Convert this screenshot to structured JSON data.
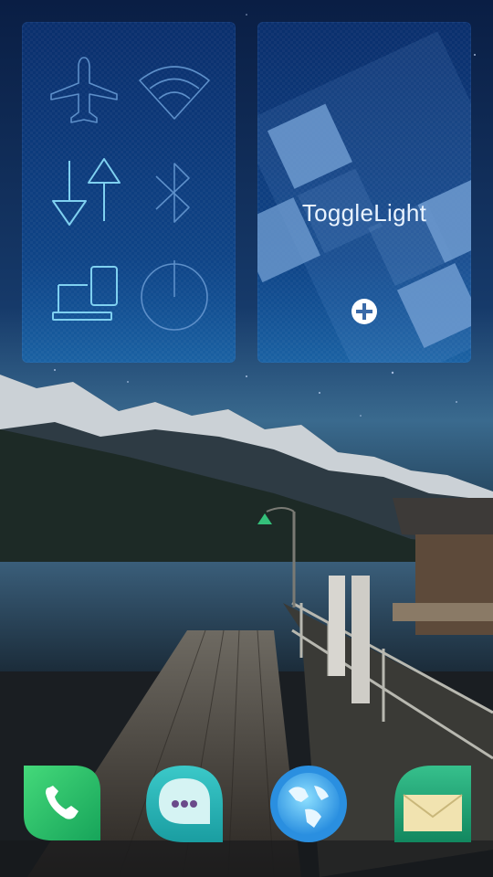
{
  "screen": {
    "name": "sailfish-home-events"
  },
  "colors": {
    "panel_top": "#0a3070",
    "panel_bottom": "#1864aa",
    "icon_stroke": "#5d8fc9",
    "icon_active": "#7fd0f0",
    "phone_green": "#2fcf6e",
    "messages_teal": "#22b3b6",
    "browser_blue": "#2a8fe0",
    "mail_green": "#1ea27a"
  },
  "quick_settings": {
    "toggles": [
      {
        "name": "flight-mode",
        "icon": "airplane-icon",
        "active": false
      },
      {
        "name": "wlan",
        "icon": "wifi-icon",
        "active": false
      },
      {
        "name": "mobile-data",
        "icon": "mobile-data-icon",
        "active": true
      },
      {
        "name": "bluetooth",
        "icon": "bluetooth-icon",
        "active": false
      },
      {
        "name": "usb-mode",
        "icon": "usb-connection-icon",
        "active": true
      },
      {
        "name": "power",
        "icon": "power-icon",
        "active": false
      }
    ]
  },
  "app_tile": {
    "title": "ToggleLight",
    "action_icon": "add-icon"
  },
  "dock": {
    "apps": [
      {
        "name": "phone",
        "icon": "phone-icon"
      },
      {
        "name": "messages",
        "icon": "messages-icon"
      },
      {
        "name": "browser",
        "icon": "globe-icon"
      },
      {
        "name": "email",
        "icon": "mail-icon"
      }
    ]
  }
}
